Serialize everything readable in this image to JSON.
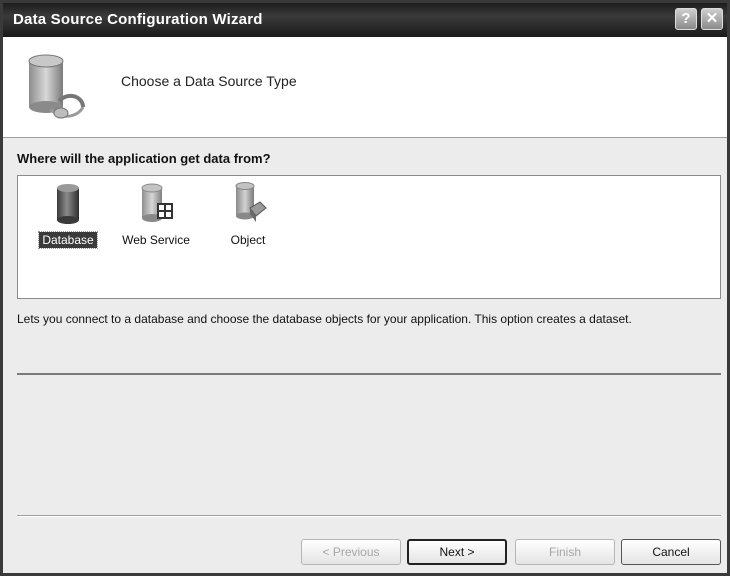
{
  "window": {
    "title": "Data Source Configuration Wizard"
  },
  "titlebar": {
    "help_label": "?",
    "close_label": "✕"
  },
  "header": {
    "title": "Choose a Data Source Type"
  },
  "question": "Where will the application get data from?",
  "sources": [
    {
      "label": "Database",
      "icon": "database-icon",
      "selected": true
    },
    {
      "label": "Web Service",
      "icon": "web-service-icon",
      "selected": false
    },
    {
      "label": "Object",
      "icon": "object-icon",
      "selected": false
    }
  ],
  "description": "Lets you connect to a database and choose the database objects for your application. This option creates a dataset.",
  "buttons": {
    "previous": "< Previous",
    "next": "Next >",
    "finish": "Finish",
    "cancel": "Cancel"
  }
}
